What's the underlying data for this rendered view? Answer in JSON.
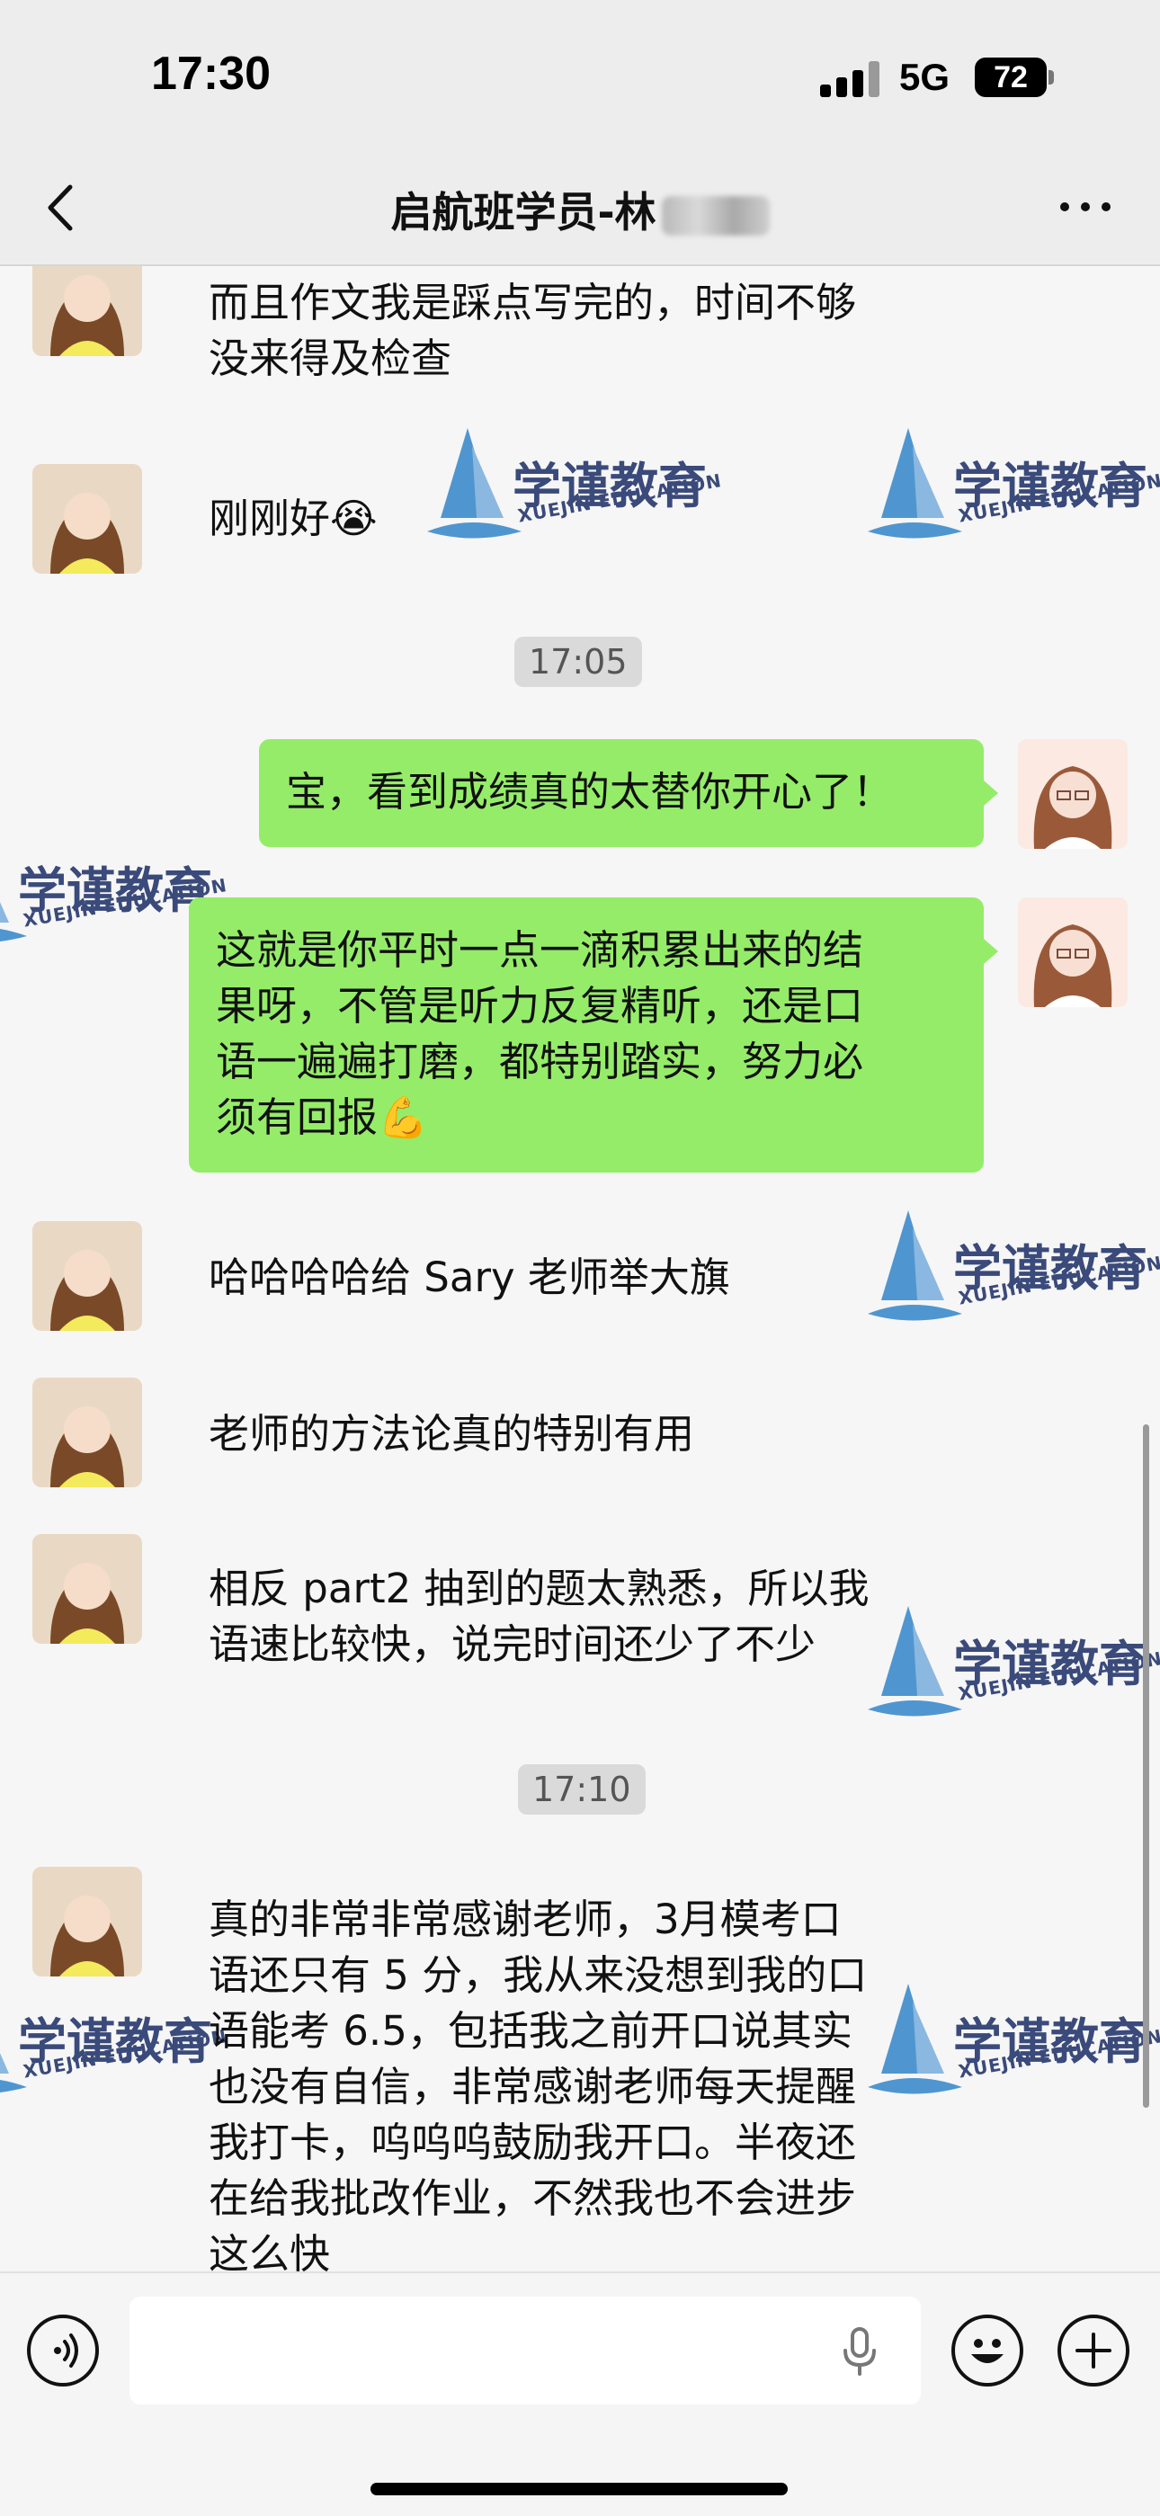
{
  "status_bar": {
    "time": "17:30",
    "network": "5G",
    "battery": "72"
  },
  "nav": {
    "title": "启航班学员-林",
    "back_icon": "chevron-left-icon",
    "more_icon": "more-dots-icon"
  },
  "watermark": {
    "brand": "学谨教育",
    "subtitle": "XUEJIN EDUCATION",
    "color": "#4f96d0"
  },
  "messages": [
    {
      "sender": "student",
      "lines": [
        "而且作文我是踩点写完的，时间不够",
        "没来得及检查"
      ]
    },
    {
      "sender": "student",
      "lines": [
        "刚刚好😭"
      ]
    },
    {
      "timestamp": "17:05"
    },
    {
      "sender": "teacher",
      "lines": [
        "宝，看到成绩真的太替你开心了！"
      ]
    },
    {
      "sender": "teacher",
      "lines": [
        "这就是你平时一点一滴积累出来的结",
        "果呀，不管是听力反复精听，还是口",
        "语一遍遍打磨，都特别踏实，努力必",
        "须有回报💪"
      ]
    },
    {
      "sender": "student",
      "lines": [
        "哈哈哈哈给 Sary 老师举大旗"
      ]
    },
    {
      "sender": "student",
      "lines": [
        "老师的方法论真的特别有用"
      ]
    },
    {
      "sender": "student",
      "lines": [
        "相反 part2 抽到的题太熟悉，所以我",
        "语速比较快，说完时间还少了不少"
      ]
    },
    {
      "timestamp": "17:10"
    },
    {
      "sender": "student",
      "lines": [
        "真的非常非常感谢老师，3月模考口",
        "语还只有 5 分，我从来没想到我的口",
        "语能考 6.5，包括我之前开口说其实",
        "也没有自信，非常感谢老师每天提醒",
        "我打卡，呜呜呜鼓励我开口。半夜还",
        "在给我批改作业，不然我也不会进步",
        "这么快"
      ]
    }
  ],
  "colors": {
    "outgoing_bubble": "#95ec69",
    "chat_bg": "#f6f6f6",
    "bar_bg": "#ededed"
  },
  "input_bar": {
    "voice_icon": "voice-icon",
    "mic_icon": "mic-icon",
    "emoji_icon": "emoji-icon",
    "add_icon": "plus-icon"
  }
}
